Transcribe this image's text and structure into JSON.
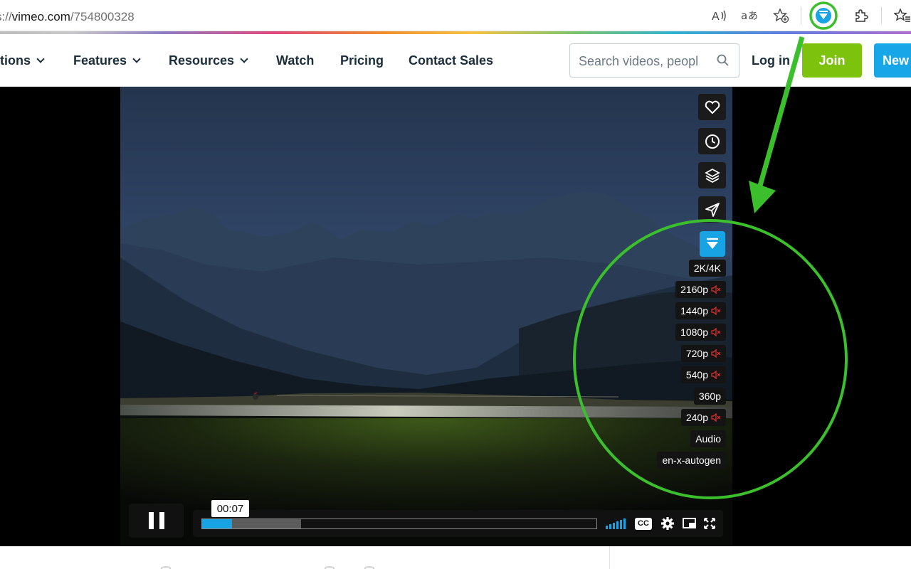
{
  "browser": {
    "url_prefix": "s://",
    "url_host": "vimeo.com",
    "url_path": "/754800328",
    "icons": [
      "read-aloud-icon",
      "translate-icon",
      "add-favorite-icon",
      "video-downloader-extension-icon",
      "extensions-icon",
      "favorites-icon"
    ]
  },
  "header": {
    "nav": [
      "tions",
      "Features",
      "Resources",
      "Watch",
      "Pricing",
      "Contact Sales"
    ],
    "search_placeholder": "Search videos, peopl",
    "login": "Log in",
    "join": "Join",
    "new": "New"
  },
  "player": {
    "current_time": "00:07",
    "played_fraction": 0.075,
    "buffered_fraction": 0.25,
    "side_icons": [
      "heart-icon",
      "clock-icon",
      "layers-icon",
      "send-icon"
    ],
    "quality_options": [
      {
        "label": "2K/4K",
        "muted": false
      },
      {
        "label": "2160p",
        "muted": true
      },
      {
        "label": "1440p",
        "muted": true
      },
      {
        "label": "1080p",
        "muted": true
      },
      {
        "label": "720p",
        "muted": true
      },
      {
        "label": "540p",
        "muted": true
      },
      {
        "label": "360p",
        "muted": false
      },
      {
        "label": "240p",
        "muted": true
      },
      {
        "label": "Audio",
        "muted": false
      },
      {
        "label": "en-x-autogen",
        "muted": false
      }
    ],
    "controls": {
      "cc": "CC"
    }
  },
  "colors": {
    "brand_blue": "#18a3e5",
    "join_green": "#7dc20d",
    "annotation_green": "#3cbf2d",
    "mute_red": "#e5322d"
  }
}
